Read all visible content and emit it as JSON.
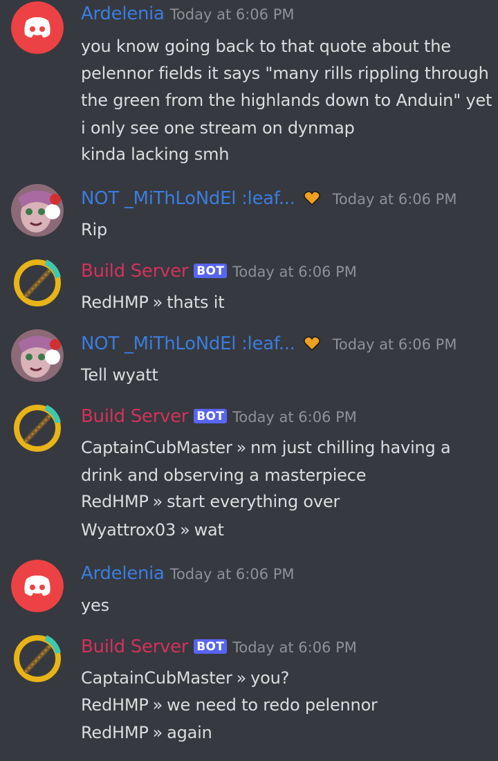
{
  "accent": "#3b7de0",
  "bot_color": "#d2325c",
  "messages": [
    {
      "author": "Ardelenia",
      "avatar": "discord-logo-icon",
      "timestamp": "Today at 6:06 PM",
      "lines": [
        "you know going back to that quote about the",
        "pelennor fields it says \"many rills rippling through",
        "the green from the highlands down to Anduin\" yet",
        "i only see one stream on dynmap",
        "kinda lacking smh"
      ]
    },
    {
      "author": "NOT _MiThLoNdEl :leaf...",
      "avatar": "anime-character-avatar",
      "badge": "orange-heart-badge-icon",
      "timestamp": "Today at 6:06 PM",
      "lines": [
        "Rip"
      ]
    },
    {
      "author": "Build Server",
      "bot_tag": "BOT",
      "avatar": "pickaxe-ring-icon",
      "timestamp": "Today at 6:06 PM",
      "lines": [
        {
          "user": "RedHMP",
          "sep": "»",
          "text": "thats it"
        }
      ]
    },
    {
      "author": "NOT _MiThLoNdEl :leaf...",
      "avatar": "anime-character-avatar",
      "badge": "orange-heart-badge-icon",
      "timestamp": "Today at 6:06 PM",
      "lines": [
        "Tell wyatt"
      ]
    },
    {
      "author": "Build Server",
      "bot_tag": "BOT",
      "avatar": "pickaxe-ring-icon",
      "timestamp": "Today at 6:06 PM",
      "lines": [
        {
          "user": "CaptainCubMaster",
          "sep": "»",
          "text": "nm just chilling having a"
        },
        "drink and observing a masterpiece",
        {
          "user": "RedHMP",
          "sep": "»",
          "text": "start everything over"
        },
        {
          "user": "Wyattrox03",
          "sep": "»",
          "text": "wat"
        }
      ]
    },
    {
      "author": "Ardelenia",
      "avatar": "discord-logo-icon",
      "timestamp": "Today at 6:06 PM",
      "lines": [
        "yes"
      ]
    },
    {
      "author": "Build Server",
      "bot_tag": "BOT",
      "avatar": "pickaxe-ring-icon",
      "timestamp": "Today at 6:06 PM",
      "lines": [
        {
          "user": "CaptainCubMaster",
          "sep": "»",
          "text": "you?"
        },
        {
          "user": "RedHMP",
          "sep": "»",
          "text": "we need to redo pelennor"
        },
        {
          "user": "RedHMP",
          "sep": "»",
          "text": "again"
        }
      ]
    }
  ]
}
